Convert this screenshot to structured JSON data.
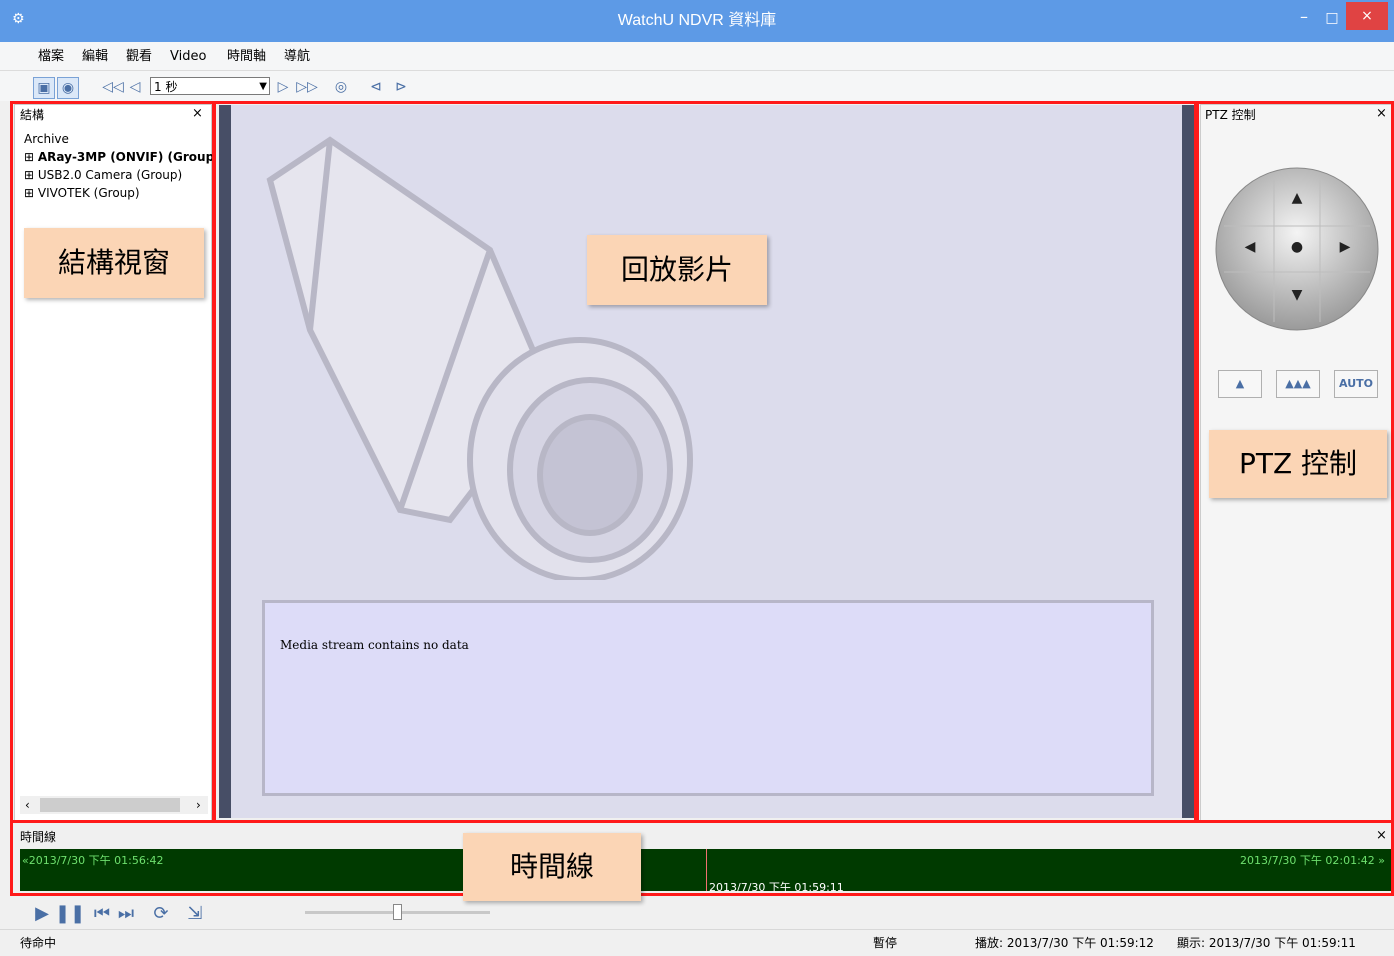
{
  "window": {
    "title": "WatchU NDVR 資料庫",
    "app_icon": "app-icon",
    "minimize": "–",
    "maximize": "□",
    "close": "×"
  },
  "menu": [
    "檔案",
    "編輯",
    "觀看",
    "Video",
    "時間軸",
    "導航"
  ],
  "toolbar": {
    "rate_value": "1 秒",
    "icons": [
      "view-layout-icon",
      "camera-view-icon",
      "fast-rewind-icon",
      "step-back-icon",
      "step-forward-icon",
      "fast-forward-icon",
      "snapshot-icon",
      "prev-marker-icon",
      "next-marker-icon"
    ]
  },
  "structure": {
    "title": "結構",
    "close": "×",
    "root": "Archive",
    "items": [
      "ARay-3MP (ONVIF) (Group",
      "USB2.0 Camera (Group)",
      "VIVOTEK (Group)"
    ],
    "callout": "結構視窗"
  },
  "video": {
    "message": "Media stream contains no data",
    "callout": "回放影片"
  },
  "ptz": {
    "title": "PTZ 控制",
    "close": "×",
    "buttons": [
      "▲",
      "▲▲▲",
      "AUTO"
    ],
    "callout": "PTZ 控制"
  },
  "timeline": {
    "title": "時間線",
    "close": "×",
    "start": "«2013/7/30 下午 01:56:42",
    "end": "2013/7/30 下午 02:01:42 »",
    "current": "2013/7/30 下午 01:59:11",
    "callout": "時間線"
  },
  "status": {
    "left": "待命中",
    "state": "暫停",
    "play": "播放: 2013/7/30 下午 01:59:12",
    "display": "顯示: 2013/7/30 下午 01:59:11"
  },
  "colors": {
    "annotation_red": "#ff1a1a",
    "callout_bg": "#fbd5b5",
    "titlebar": "#5d9ae6",
    "timeline_bg": "#003a00"
  }
}
